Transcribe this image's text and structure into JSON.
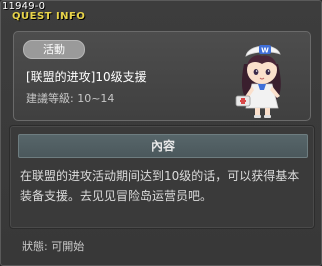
{
  "window": {
    "id_label": "11949-0",
    "title": "QUEST INFO"
  },
  "quest": {
    "category_badge": "活動",
    "name": "[联盟的进攻]10级支援",
    "level_requirement": "建議等級: 10~14"
  },
  "content": {
    "header": "內容",
    "body": "在联盟的进攻活动期间达到10级的话，可以获得基本装备支援。去见见冒险岛运营员吧。"
  },
  "status": {
    "text": "狀態: 可開始"
  },
  "icons": {
    "close": "close-icon",
    "npc": "npc-operator-character"
  },
  "colors": {
    "title": "#e8d44a",
    "badge_bg": "#9a9a9a",
    "content_header_bg": "#57666a"
  }
}
